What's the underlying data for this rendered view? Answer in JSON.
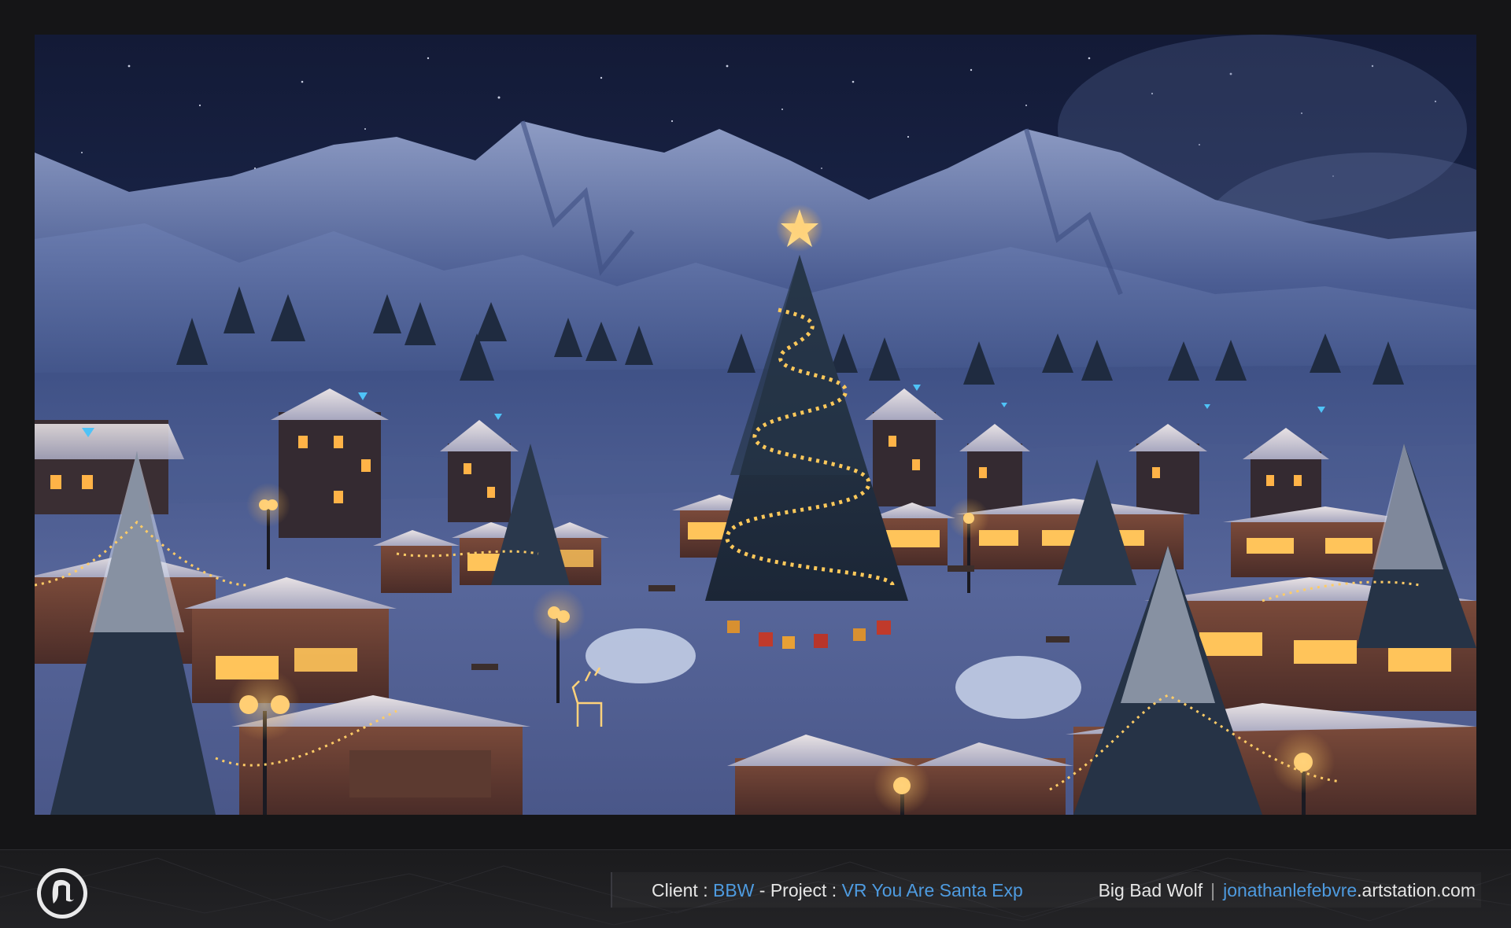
{
  "footer": {
    "client_label": "Client :",
    "client_value": "BBW",
    "project_sep": " - ",
    "project_label": "Project :",
    "project_value": "VR You Are Santa Exp",
    "studio": "Big Bad Wolf",
    "divider": "|",
    "artist_link_name": "jonathanlefebvre",
    "artist_link_domain": ".artstation.com",
    "logo": "unreal-engine-logo-icon"
  },
  "colors": {
    "accent": "#4e9be0",
    "text": "#e6e6e6",
    "sky": "#16203e",
    "snow": "#c9d3ea",
    "light": "#ffcc66"
  }
}
